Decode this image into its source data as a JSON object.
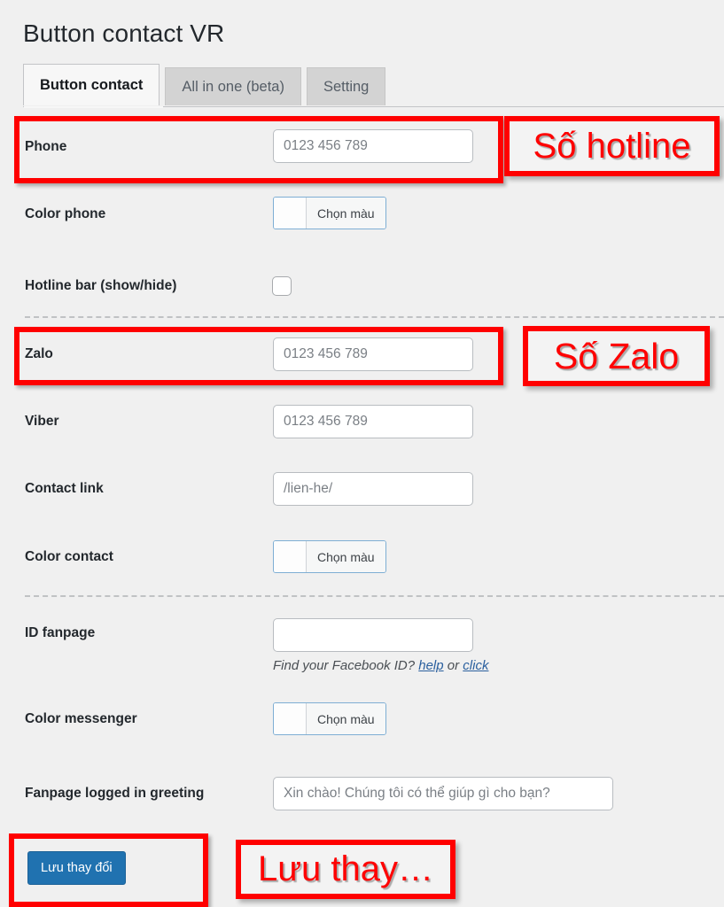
{
  "page": {
    "title": "Button contact VR",
    "background_color": "#f0f0f0"
  },
  "tabs": [
    {
      "label": "Button contact",
      "active": true
    },
    {
      "label": "All in one (beta)",
      "active": false
    },
    {
      "label": "Setting",
      "active": false
    }
  ],
  "form": {
    "rows": [
      {
        "label": "Phone",
        "type": "text",
        "value": "",
        "placeholder": "0123 456 789"
      },
      {
        "label": "Color phone",
        "type": "color",
        "button_label": "Chọn màu",
        "swatch_color": "#ffffff"
      },
      {
        "label": "Hotline bar (show/hide)",
        "type": "checkbox",
        "checked": false
      },
      {
        "label": "Zalo",
        "type": "text",
        "value": "",
        "placeholder": "0123 456 789"
      },
      {
        "label": "Viber",
        "type": "text",
        "value": "",
        "placeholder": "0123 456 789"
      },
      {
        "label": "Contact link",
        "type": "text",
        "value": "",
        "placeholder": "/lien-he/"
      },
      {
        "label": "Color contact",
        "type": "color",
        "button_label": "Chọn màu",
        "swatch_color": "#ffffff"
      },
      {
        "label": "ID fanpage",
        "type": "text",
        "value": "",
        "placeholder": ""
      },
      {
        "label": "Color messenger",
        "type": "color",
        "button_label": "Chọn màu",
        "swatch_color": "#ffffff"
      },
      {
        "label": "Fanpage logged in greeting",
        "type": "text",
        "value": "",
        "placeholder": "Xin chào! Chúng tôi có thể giúp gì cho bạn?"
      }
    ],
    "helper": {
      "prefix": "Find your Facebook ID?",
      "link1": "help",
      "middle": "or",
      "link2": "click"
    },
    "save_button": "Lưu thay đổi"
  },
  "annotations": {
    "accent_color": "#ff0000",
    "callouts": [
      {
        "text": "Số hotline",
        "target": "Phone"
      },
      {
        "text": "Số Zalo",
        "target": "Zalo"
      },
      {
        "text": "Lưu thay…",
        "target": "Lưu thay đổi"
      }
    ]
  }
}
